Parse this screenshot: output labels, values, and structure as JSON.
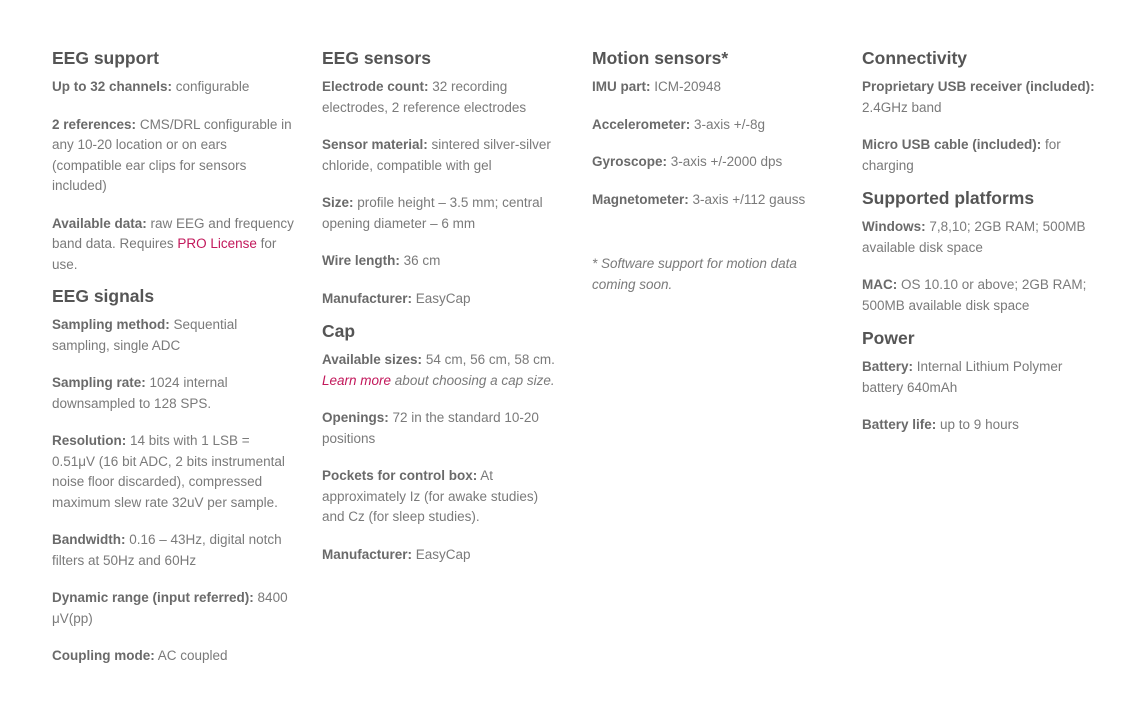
{
  "columns": [
    {
      "sections": [
        {
          "title": "EEG support",
          "items": [
            {
              "label": "Up to 32 channels:",
              "text": " configurable"
            },
            {
              "label": "2 references:",
              "text": " CMS/DRL configurable in any 10-20 location or on ears (compatible ear clips for sensors included)"
            },
            {
              "label": "Available data:",
              "text": " raw EEG and frequency band data. Requires ",
              "link": "PRO License",
              "after": " for use."
            }
          ]
        },
        {
          "title": "EEG signals",
          "items": [
            {
              "label": "Sampling method:",
              "text": " Sequential sampling, single ADC"
            },
            {
              "label": "Sampling rate:",
              "text": " 1024 internal downsampled to 128 SPS."
            },
            {
              "label": "Resolution:",
              "text": " 14 bits with 1 LSB = 0.51μV (16 bit ADC, 2 bits instrumental noise floor discarded), compressed maximum slew rate 32uV per sample."
            },
            {
              "label": "Bandwidth:",
              "text": " 0.16 – 43Hz, digital notch filters at 50Hz and 60Hz"
            },
            {
              "label": "Dynamic range (input referred):",
              "text": " 8400 μV(pp)"
            },
            {
              "label": "Coupling mode:",
              "text": " AC coupled"
            }
          ]
        }
      ]
    },
    {
      "sections": [
        {
          "title": "EEG sensors",
          "items": [
            {
              "label": "Electrode count:",
              "text": " 32 recording electrodes, 2 reference electrodes"
            },
            {
              "label": "Sensor material:",
              "text": " sintered silver-silver chloride, compatible with gel"
            },
            {
              "label": "Size:",
              "text": " profile height – 3.5 mm; central opening diameter – 6 mm"
            },
            {
              "label": "Wire length:",
              "text": " 36 cm"
            },
            {
              "label": "Manufacturer:",
              "text": " EasyCap"
            }
          ]
        },
        {
          "title": "Cap",
          "items": [
            {
              "label": "Available sizes:",
              "text": " 54 cm, 56 cm, 58 cm. ",
              "link": "Learn more",
              "after": " about choosing a cap size.",
              "italic_tail": true
            },
            {
              "label": "Openings:",
              "text": " 72 in the standard 10-20 positions"
            },
            {
              "label": "Pockets for control box:",
              "text": " At approximately Iz (for awake studies) and Cz (for sleep studies)."
            },
            {
              "label": "Manufacturer:",
              "text": " EasyCap"
            }
          ]
        }
      ]
    },
    {
      "sections": [
        {
          "title": "Motion sensors*",
          "items": [
            {
              "label": "IMU part:",
              "text": " ICM-20948"
            },
            {
              "label": "Accelerometer:",
              "text": " 3-axis +/-8g"
            },
            {
              "label": "Gyroscope:",
              "text": " 3-axis +/-2000 dps"
            },
            {
              "label": "Magnetometer:",
              "text": " 3-axis +/112 gauss"
            }
          ],
          "note": "* Software support for motion data coming soon."
        }
      ]
    },
    {
      "sections": [
        {
          "title": "Connectivity",
          "items": [
            {
              "label": "Proprietary USB receiver (included):",
              "text": " 2.4GHz band"
            },
            {
              "label": "Micro USB cable (included):",
              "text": " for charging"
            }
          ]
        },
        {
          "title": "Supported platforms",
          "items": [
            {
              "label": "Windows:",
              "text": " 7,8,10; 2GB RAM; 500MB available disk space"
            },
            {
              "label": "MAC:",
              "text": " OS 10.10 or above; 2GB RAM; 500MB available disk space"
            }
          ]
        },
        {
          "title": "Power",
          "items": [
            {
              "label": "Battery:",
              "text": " Internal Lithium Polymer battery 640mAh"
            },
            {
              "label": "Battery life:",
              "text": " up to 9 hours"
            }
          ]
        }
      ]
    }
  ],
  "colors": {
    "text": "#7a7a7a",
    "heading": "#555555",
    "link": "#c2185b"
  }
}
